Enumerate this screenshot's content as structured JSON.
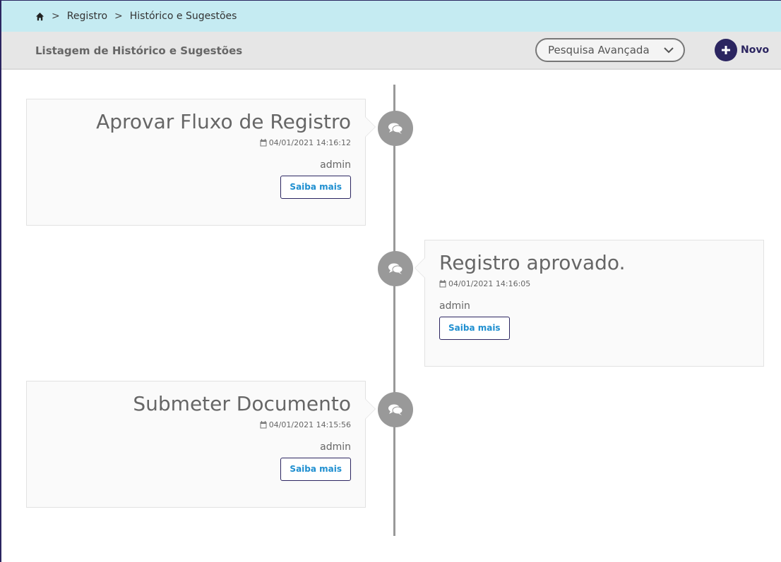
{
  "breadcrumb": {
    "home_icon": "home-icon",
    "separator": ">",
    "items": [
      "Registro",
      "Histórico e Sugestões"
    ]
  },
  "header": {
    "title": "Listagem de Histórico e Sugestões",
    "search_label": "Pesquisa Avançada",
    "new_label": "Novo"
  },
  "colors": {
    "breadcrumb_bg": "#c5ebf2",
    "accent": "#2b2560",
    "link": "#1f8fd0"
  },
  "timeline": {
    "entries": [
      {
        "title": "Aprovar Fluxo de Registro",
        "date": "04/01/2021 14:16:12",
        "author": "admin",
        "button": "Saiba mais",
        "side": "left"
      },
      {
        "title": "Registro aprovado.",
        "date": "04/01/2021 14:16:05",
        "author": "admin",
        "button": "Saiba mais",
        "side": "right"
      },
      {
        "title": "Submeter Documento",
        "date": "04/01/2021 14:15:56",
        "author": "admin",
        "button": "Saiba mais",
        "side": "left"
      }
    ]
  }
}
